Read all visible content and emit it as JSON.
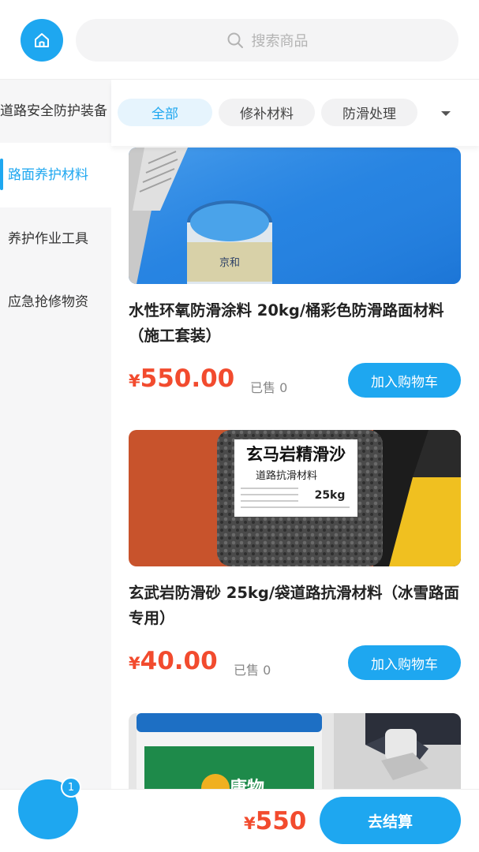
{
  "header": {
    "home_icon": "home-icon",
    "search_icon": "search-icon",
    "search_placeholder": "搜索商品"
  },
  "sidebar": {
    "items": [
      {
        "label": "道路安全防护装备",
        "active": false
      },
      {
        "label": "路面养护材料",
        "active": true
      },
      {
        "label": "养护作业工具",
        "active": false
      },
      {
        "label": "应急抢修物资",
        "active": false
      }
    ]
  },
  "tabs": {
    "items": [
      {
        "label": "全部",
        "active": true
      },
      {
        "label": "修补材料",
        "active": false
      },
      {
        "label": "防滑处理",
        "active": false
      }
    ],
    "dropdown_icon": "caret-down-icon"
  },
  "products": [
    {
      "title": "水性环氧防滑涂料 20kg/桶彩色防滑路面材料（施工套装）",
      "currency": "¥",
      "price": "550.00",
      "sold": "已售 0",
      "button": "加入购物车",
      "image_text": [
        "京和"
      ]
    },
    {
      "title": "玄武岩防滑砂 25kg/袋道路抗滑材料（冰雪路面专用）",
      "currency": "¥",
      "price": "40.00",
      "sold": "已售 0",
      "button": "加入购物车",
      "image_text": [
        "玄马岩精滑沙",
        "道路抗滑材料",
        "25kg"
      ]
    },
    {
      "image_text": [
        "康物"
      ]
    }
  ],
  "bottom_bar": {
    "cart_count": "1",
    "currency": "¥",
    "total": "550",
    "checkout_label": "去结算"
  },
  "colors": {
    "accent": "#1ea7f0",
    "price": "#f24b2e",
    "sidebar_bg": "#f6f6f7"
  }
}
